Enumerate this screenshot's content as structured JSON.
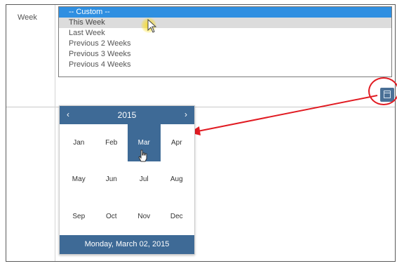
{
  "form": {
    "week_label": "Week",
    "week_options": [
      {
        "label": "-- Custom --",
        "state": "selected"
      },
      {
        "label": "This Week",
        "state": "hover"
      },
      {
        "label": "Last Week",
        "state": "normal"
      },
      {
        "label": "Previous 2 Weeks",
        "state": "normal"
      },
      {
        "label": "Previous 3 Weeks",
        "state": "normal"
      },
      {
        "label": "Previous 4 Weeks",
        "state": "normal"
      }
    ],
    "calendar_button_icon": "calendar-icon"
  },
  "picker": {
    "prev_symbol": "‹",
    "next_symbol": "›",
    "year": "2015",
    "months": [
      "Jan",
      "Feb",
      "Mar",
      "Apr",
      "May",
      "Jun",
      "Jul",
      "Aug",
      "Sep",
      "Oct",
      "Nov",
      "Dec"
    ],
    "active_month": "Mar",
    "footer": "Monday, March 02, 2015"
  },
  "colors": {
    "selected_option": "#2f8fe1",
    "hover_option": "#dcdcdc",
    "picker_accent": "#3e6a96",
    "annotation": "#e11b22"
  }
}
